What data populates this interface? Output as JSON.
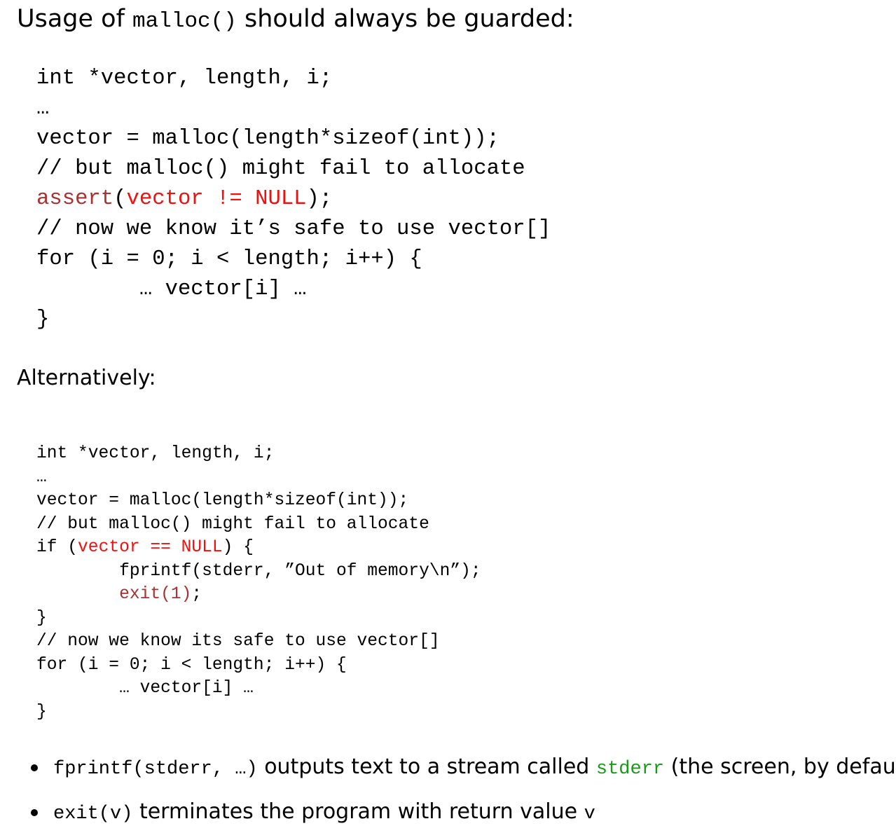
{
  "heading": {
    "pre": "Usage of ",
    "code": "malloc()",
    "post": " should always be guarded:"
  },
  "code1": [
    [
      [
        "int *vector, length, i;",
        ""
      ]
    ],
    [
      [
        "…",
        ""
      ]
    ],
    [
      [
        "vector = malloc(length*sizeof(int));",
        ""
      ]
    ],
    [
      [
        "// but malloc() might fail to allocate",
        ""
      ]
    ],
    [
      [
        "assert",
        "dred"
      ],
      [
        "(",
        ""
      ],
      [
        "vector != NULL",
        "red"
      ],
      [
        ");",
        ""
      ]
    ],
    [
      [
        "// now we know it’s safe to use vector[]",
        ""
      ]
    ],
    [
      [
        "for (i = 0; i < length; i++) {",
        ""
      ]
    ],
    [
      [
        "        … vector[i] …",
        ""
      ]
    ],
    [
      [
        "}",
        ""
      ]
    ]
  ],
  "alt_label": "Alternatively:",
  "code2": [
    [
      [
        "int *vector, length, i;",
        ""
      ]
    ],
    [
      [
        "…",
        ""
      ]
    ],
    [
      [
        "vector = malloc(length*sizeof(int));",
        ""
      ]
    ],
    [
      [
        "// but malloc() might fail to allocate",
        ""
      ]
    ],
    [
      [
        "if (",
        ""
      ],
      [
        "vector == NULL",
        "red"
      ],
      [
        ") {",
        ""
      ]
    ],
    [
      [
        "        fprintf(stderr, ”Out of memory\\n”);",
        ""
      ]
    ],
    [
      [
        "        ",
        ""
      ],
      [
        "exit(1)",
        "dred"
      ],
      [
        ";",
        ""
      ]
    ],
    [
      [
        "}",
        ""
      ]
    ],
    [
      [
        "// now we know its safe to use vector[]",
        ""
      ]
    ],
    [
      [
        "for (i = 0; i < length; i++) {",
        ""
      ]
    ],
    [
      [
        "        … vector[i] …",
        ""
      ]
    ],
    [
      [
        "}",
        ""
      ]
    ]
  ],
  "bullets": [
    {
      "code": "fprintf(stderr, …)",
      "text": " outputs text to a stream called ",
      "code2": "stderr",
      "text2": " (the screen, by default)"
    },
    {
      "code": "exit(v)",
      "text": " terminates the program with return value ",
      "code2": "v",
      "text2": ""
    }
  ],
  "colors": {
    "red": "#f01010",
    "dark_red": "#a83232",
    "green": "#1a9a1a"
  }
}
